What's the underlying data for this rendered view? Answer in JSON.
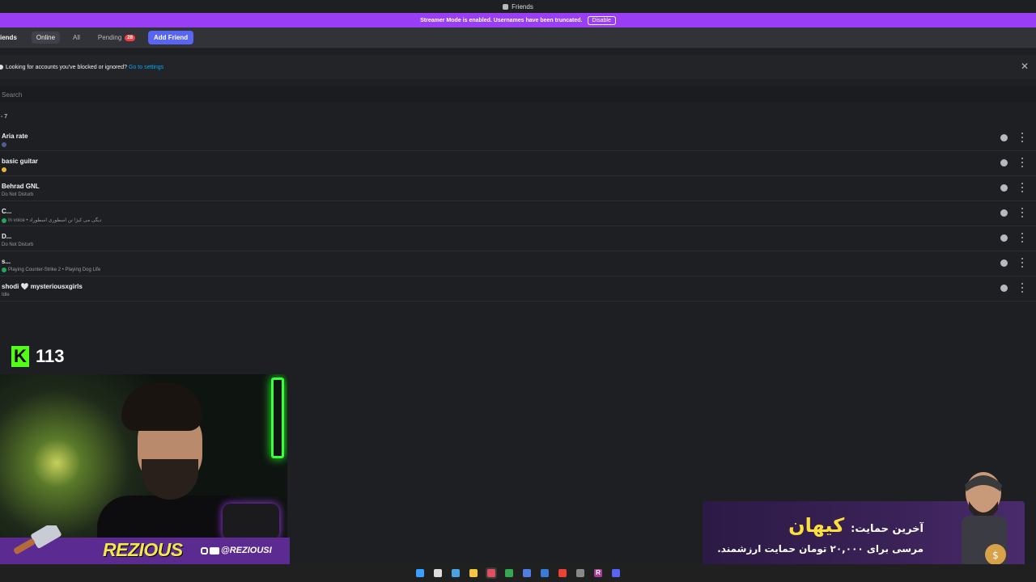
{
  "window": {
    "title": "Friends"
  },
  "streamer_banner": {
    "text": "Streamer Mode is enabled. Usernames have been truncated.",
    "button": "Disable"
  },
  "tabs": {
    "friends": "iends",
    "online": "Online",
    "all": "All",
    "pending": "Pending",
    "pending_count": "28",
    "add_friend": "Add Friend"
  },
  "notice": {
    "text": "Looking for accounts you've blocked or ignored?",
    "link": "Go to settings"
  },
  "search": {
    "placeholder": "Search"
  },
  "online_count": "- 7",
  "friends": [
    {
      "name": "Aria rate",
      "status": "",
      "status_color": "#4e5d94"
    },
    {
      "name": "basic guitar",
      "status": "",
      "status_color": "#f0b232"
    },
    {
      "name": "Behrad GNL",
      "status": "Do Not Disturb",
      "status_color": ""
    },
    {
      "name": "C...",
      "status": "In voice • دیگی می کیژ! نن اسطوری اسطوراد",
      "status_color": "#23a55a"
    },
    {
      "name": "D...",
      "status": "Do Not Disturb",
      "status_color": ""
    },
    {
      "name": "s...",
      "status": "Playing Counter-Strike 2 • Playing Dog Life",
      "status_color": "#23a55a"
    },
    {
      "name": "shodi 🤍 mysteriousxgirls",
      "status": "Idle",
      "status_color": ""
    }
  ],
  "kick": {
    "logo": "K",
    "viewers": "113"
  },
  "overlay": {
    "brand": "REZIOUS",
    "handle": "@REZIOUSI"
  },
  "donation": {
    "label": "آخرین حمایت:",
    "name": "کیهان",
    "message": "مرسی برای ۲۰,۰۰۰ تومان حمایت ارزشمند."
  },
  "taskbar": [
    "windows-start",
    "search",
    "app-1",
    "file-explorer",
    "app-active",
    "chrome",
    "app-2",
    "app-3",
    "chrome-2",
    "app-4",
    "app-R",
    "discord"
  ]
}
